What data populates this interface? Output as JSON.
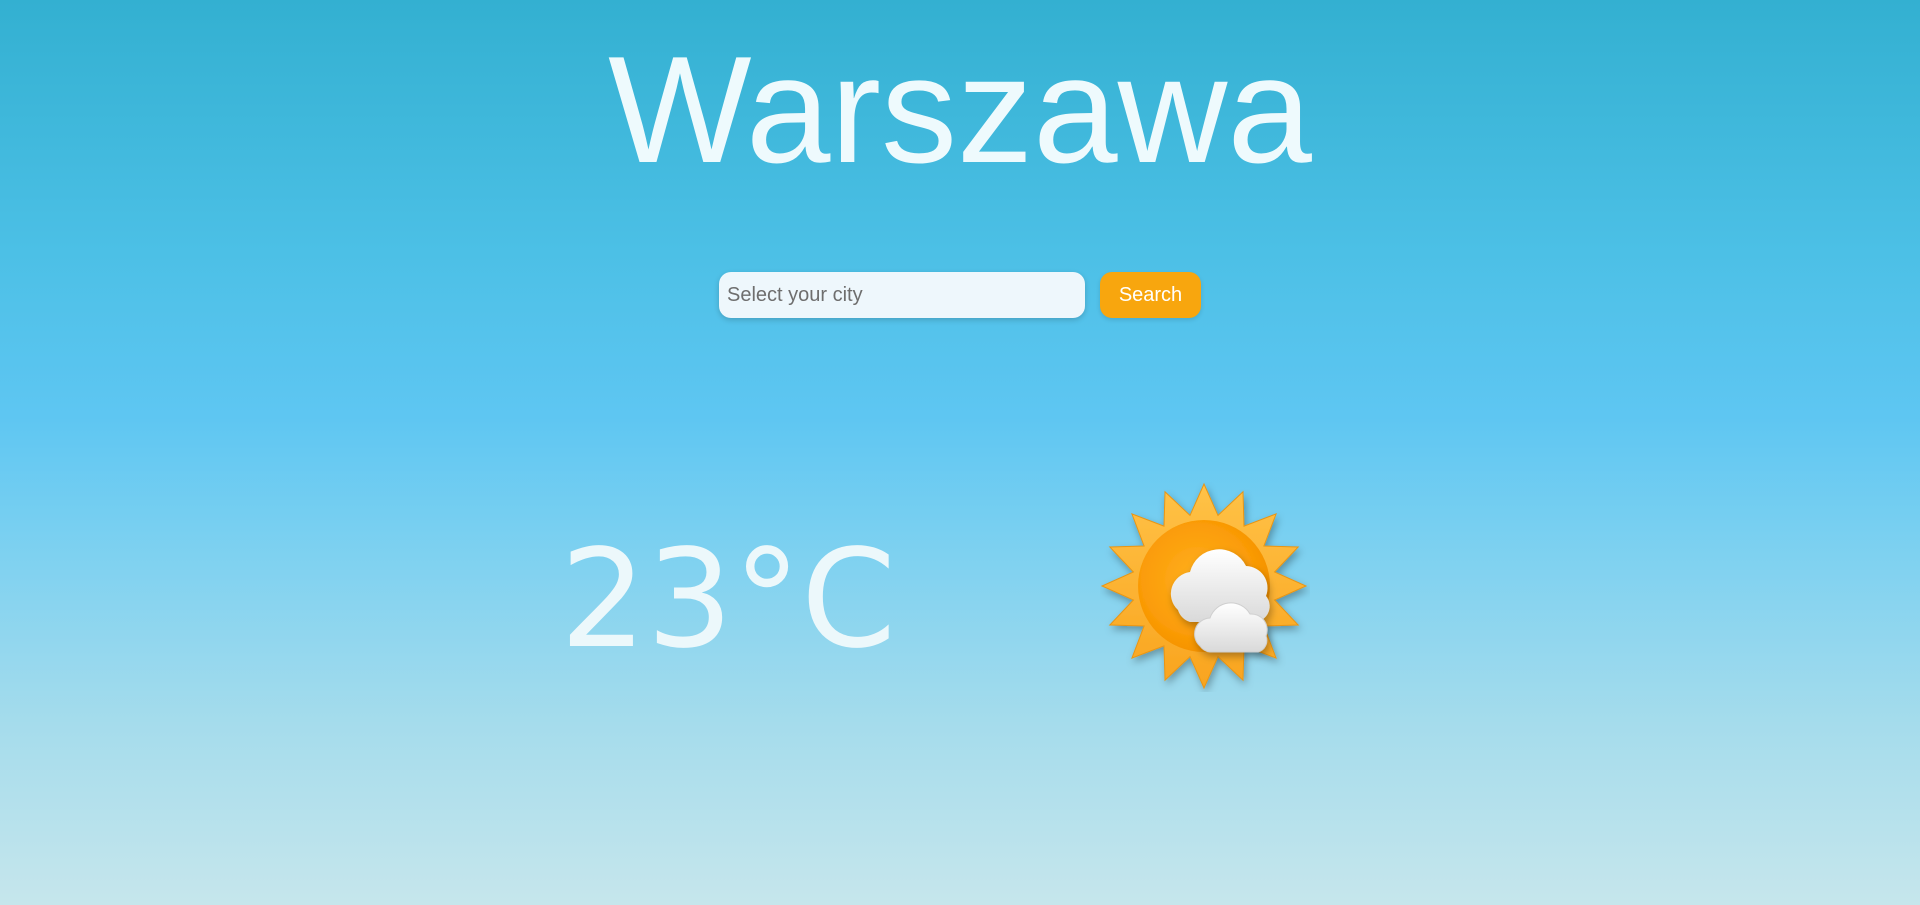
{
  "header": {
    "city": "Warszawa"
  },
  "search": {
    "placeholder": "Select your city",
    "value": "",
    "button_label": "Search"
  },
  "weather": {
    "temperature": "23°C",
    "icon": "partly-cloudy-sun-icon"
  },
  "colors": {
    "sky_top": "#33b0d1",
    "sky_mid": "#5ec6f2",
    "sky_bottom": "#c6e6ec",
    "accent": "#f8a60e",
    "text": "#eefafd"
  }
}
